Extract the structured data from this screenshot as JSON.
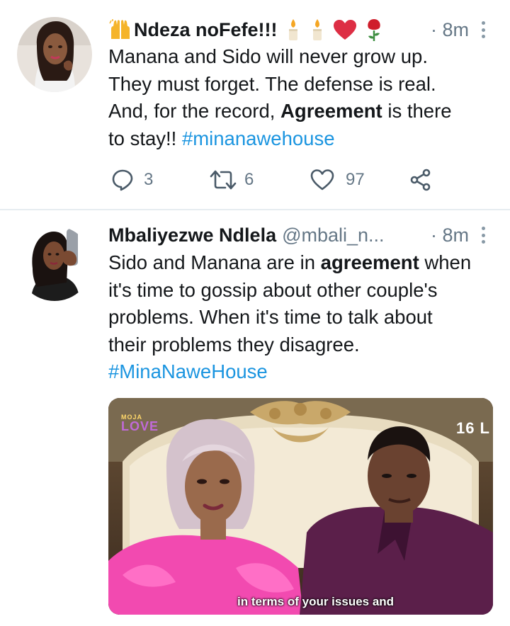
{
  "tweets": [
    {
      "display_name": "Ndeza noFefe!!!",
      "handle": "",
      "time": "· 8m",
      "emojis": [
        "raised-hands-emoji",
        "candle-emoji",
        "candle-emoji",
        "red-heart-emoji",
        "rose-emoji"
      ],
      "text_lines": [
        [
          "Manana and Sido will never grow up."
        ],
        [
          "They must forget. The defense is real."
        ],
        [
          "And, for the record, ",
          {
            "bold": "Agreement"
          },
          " is there"
        ],
        [
          "to stay!! ",
          {
            "tag": "#minanawehouse"
          }
        ]
      ],
      "replies": "3",
      "retweets": "6",
      "likes": "97"
    },
    {
      "display_name": "Mbaliyezwe Ndlela",
      "handle": "@mbali_n...",
      "time": "· 8m",
      "text_lines": [
        [
          "Sido and Manana are in ",
          {
            "bold": "agreement"
          },
          " when"
        ],
        [
          "it's time to gossip about other couple's"
        ],
        [
          "problems. When it's time to talk about"
        ],
        [
          "their problems they disagree."
        ],
        [
          {
            "tag": "#MinaNaweHouse"
          }
        ]
      ],
      "media": {
        "logo_top": "MOJA",
        "logo_bottom": "LOVE",
        "rating": "16 L",
        "subtitle": "in terms of your issues and"
      }
    }
  ],
  "colors": {
    "text": "#14171a",
    "muted": "#657786",
    "link": "#1b95e0",
    "divider": "#e6ecf0"
  }
}
